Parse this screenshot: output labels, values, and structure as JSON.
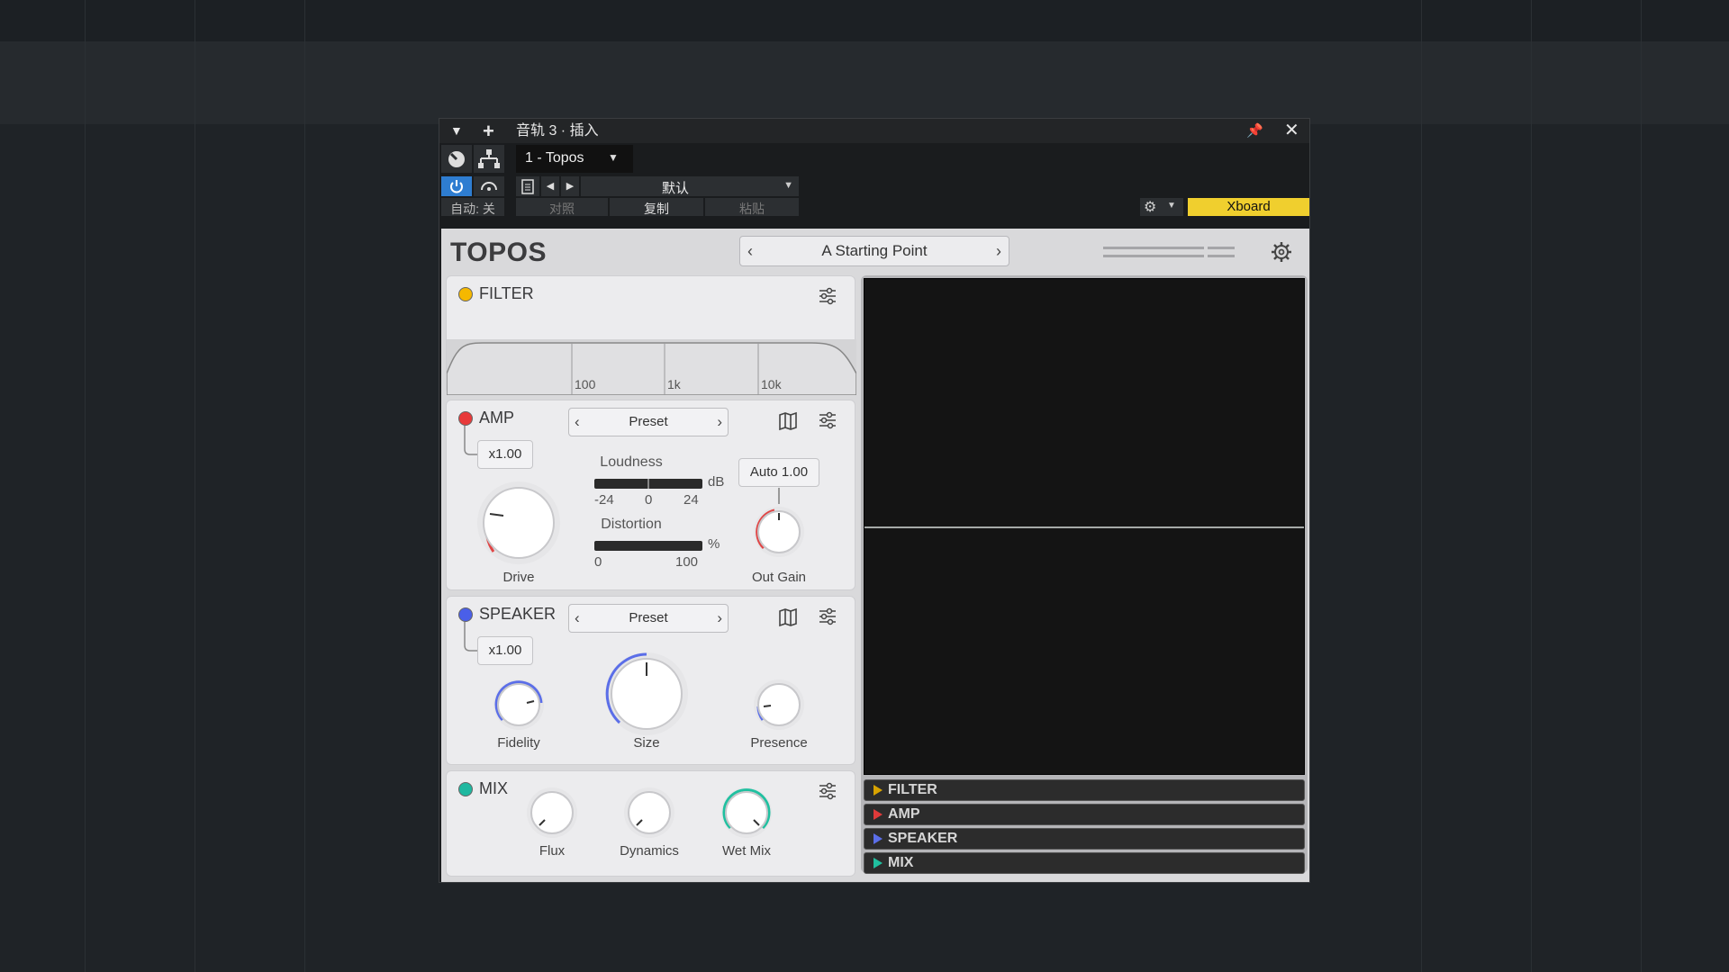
{
  "window": {
    "title": "音轨 3 · 插入",
    "track_slot": "1 - Topos",
    "preset_menu": "默认",
    "auto_label": "自动: 关",
    "compare_label": "对照",
    "copy_label": "复制",
    "paste_label": "粘贴",
    "xboard_label": "Xboard"
  },
  "plugin": {
    "name": "TOPOS",
    "preset": "A Starting Point",
    "filter": {
      "label": "FILTER",
      "freq_labels": [
        "100",
        "1k",
        "10k"
      ]
    },
    "amp": {
      "label": "AMP",
      "preset": "Preset",
      "multiplier": "x1.00",
      "drive_label": "Drive",
      "loudness_label": "Loudness",
      "loudness_unit": "dB",
      "loudness_ticks": [
        "-24",
        "0",
        "24"
      ],
      "distortion_label": "Distortion",
      "distortion_unit": "%",
      "distortion_ticks": [
        "0",
        "100"
      ],
      "auto_label": "Auto",
      "auto_value": "1.00",
      "out_gain_label": "Out Gain"
    },
    "speaker": {
      "label": "SPEAKER",
      "preset": "Preset",
      "multiplier": "x1.00",
      "fidelity_label": "Fidelity",
      "size_label": "Size",
      "presence_label": "Presence"
    },
    "mix": {
      "label": "MIX",
      "flux_label": "Flux",
      "dynamics_label": "Dynamics",
      "wetmix_label": "Wet Mix"
    },
    "lanes": [
      {
        "label": "FILTER",
        "color": "#d8a300"
      },
      {
        "label": "AMP",
        "color": "#e03a3a"
      },
      {
        "label": "SPEAKER",
        "color": "#5b6ee8"
      },
      {
        "label": "MIX",
        "color": "#20c0a0"
      }
    ]
  },
  "colors": {
    "filter_dot": "#f5b800",
    "amp_dot": "#e83a3a",
    "speaker_dot": "#4a5fe8",
    "mix_dot": "#1fb8a0",
    "xboard_bg": "#f0cf2e",
    "power_on": "#2e7dd1"
  }
}
